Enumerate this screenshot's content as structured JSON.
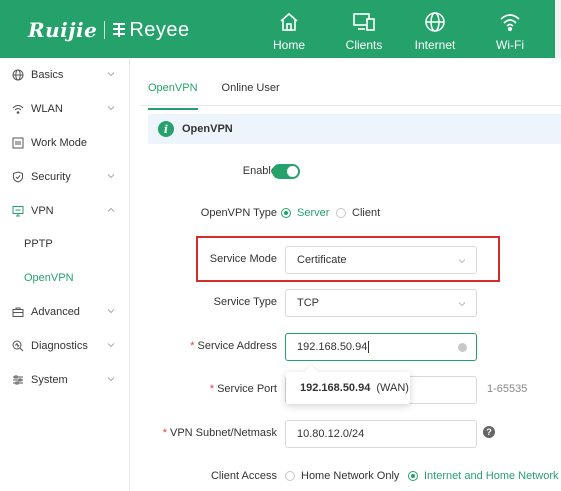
{
  "brand": {
    "name": "Ruijie",
    "product": "Reyee",
    "accent": "#25a26c"
  },
  "nav": [
    {
      "label": "Home",
      "icon": "home-icon"
    },
    {
      "label": "Clients",
      "icon": "clients-icon"
    },
    {
      "label": "Internet",
      "icon": "globe-icon"
    },
    {
      "label": "Wi-Fi",
      "icon": "wifi-icon"
    }
  ],
  "sidebar": {
    "items": [
      {
        "label": "Basics",
        "icon": "globe-icon"
      },
      {
        "label": "WLAN",
        "icon": "wifi-icon"
      },
      {
        "label": "Work Mode",
        "icon": "work-mode-icon"
      },
      {
        "label": "Security",
        "icon": "shield-icon"
      },
      {
        "label": "VPN",
        "icon": "vpn-icon"
      },
      {
        "label": "Advanced",
        "icon": "briefcase-icon"
      },
      {
        "label": "Diagnostics",
        "icon": "diagnostics-icon"
      },
      {
        "label": "System",
        "icon": "sliders-icon"
      }
    ],
    "vpn_sub": [
      {
        "label": "PPTP"
      },
      {
        "label": "OpenVPN"
      }
    ]
  },
  "tabs": [
    {
      "label": "OpenVPN"
    },
    {
      "label": "Online User"
    }
  ],
  "banner": {
    "title": "OpenVPN",
    "icon": "info-icon"
  },
  "form": {
    "enable_label": "Enable",
    "enable_on": true,
    "type_label": "OpenVPN Type",
    "type_options": [
      "Server",
      "Client"
    ],
    "type_selected": "Server",
    "service_mode_label": "Service Mode",
    "service_mode_value": "Certificate",
    "service_type_label": "Service Type",
    "service_type_value": "TCP",
    "service_address_label": "Service Address",
    "service_address_value": "192.168.50.94",
    "service_port_label": "Service Port",
    "service_port_range": "1-65535",
    "subnet_label": "VPN Subnet/Netmask",
    "subnet_value": "10.80.12.0/24",
    "client_access_label": "Client Access",
    "client_access_options": [
      "Home Network Only",
      "Internet and Home Network"
    ],
    "client_access_selected": "Internet and Home Network"
  },
  "suggestion": {
    "address": "192.168.50.94",
    "tag": "(WAN)"
  }
}
